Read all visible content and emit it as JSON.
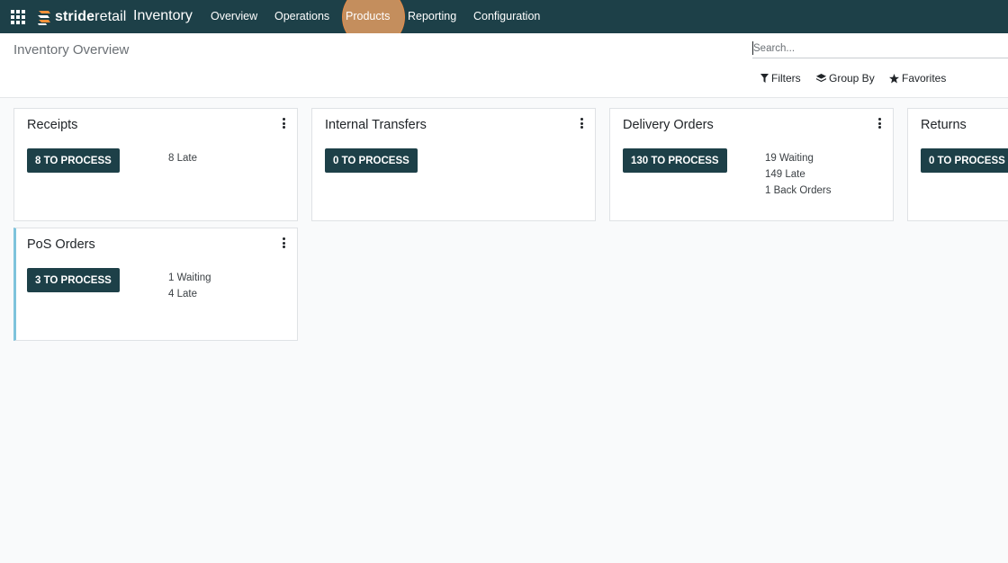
{
  "navbar": {
    "brand_bold": "stride",
    "brand_light": "retail",
    "app_name": "Inventory",
    "menu": [
      "Overview",
      "Operations",
      "Products",
      "Reporting",
      "Configuration"
    ]
  },
  "control_panel": {
    "title": "Inventory Overview",
    "search_placeholder": "Search...",
    "filters_label": "Filters",
    "group_by_label": "Group By",
    "favorites_label": "Favorites"
  },
  "cards": [
    {
      "title": "Receipts",
      "button": "8 TO PROCESS",
      "stats": [
        "8 Late"
      ]
    },
    {
      "title": "Internal Transfers",
      "button": "0 TO PROCESS",
      "stats": []
    },
    {
      "title": "Delivery Orders",
      "button": "130 TO PROCESS",
      "stats": [
        "19 Waiting",
        "149 Late",
        "1 Back Orders"
      ]
    },
    {
      "title": "Returns",
      "button": "0 TO PROCESS",
      "stats": []
    },
    {
      "title": "PoS Orders",
      "button": "3 TO PROCESS",
      "stats": [
        "1 Waiting",
        "4 Late"
      ]
    }
  ],
  "colors": {
    "navbar_bg": "#1d4048",
    "button_bg": "#1d4048",
    "card_accent": "#7ec3dc",
    "brand_orange": "#f0913a",
    "cursor_highlight": "#fca864"
  }
}
